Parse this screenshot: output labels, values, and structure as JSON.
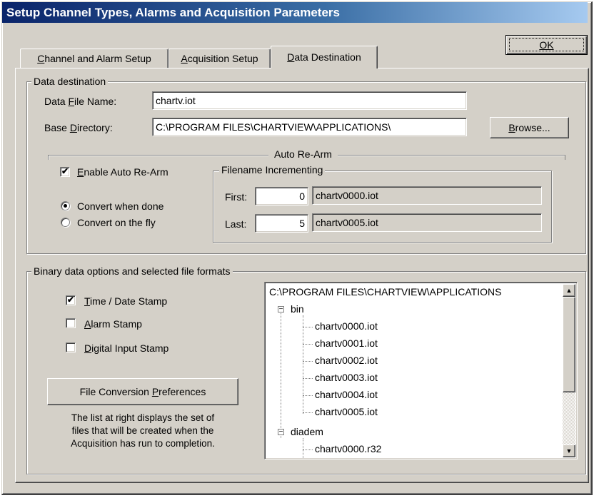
{
  "window": {
    "title": "Setup Channel Types, Alarms and Acquisition Parameters"
  },
  "ok_button": {
    "label": "OK"
  },
  "tabs": [
    {
      "pre": "",
      "key": "C",
      "post": "hannel and Alarm Setup"
    },
    {
      "pre": "",
      "key": "A",
      "post": "cquisition Setup"
    },
    {
      "pre": "",
      "key": "D",
      "post": "ata Destination"
    }
  ],
  "data_destination": {
    "group_label": "Data destination",
    "file_name_label": {
      "pre": "Data ",
      "key": "F",
      "post": "ile Name:"
    },
    "file_name_value": "chartv.iot",
    "base_dir_label": {
      "pre": "Base ",
      "key": "D",
      "post": "irectory:"
    },
    "base_dir_value": "C:\\PROGRAM FILES\\CHARTVIEW\\APPLICATIONS\\",
    "browse_button": {
      "key": "B",
      "post": "rowse..."
    },
    "auto_rearm": {
      "label": "Auto Re-Arm",
      "enable_checkbox": {
        "key": "E",
        "post": "nable Auto Re-Arm",
        "checked": true
      },
      "convert_when_done": {
        "label": "Convert when done",
        "selected": true
      },
      "convert_on_fly": {
        "label": "Convert on the fly",
        "selected": false
      },
      "filename_incrementing": {
        "group_label": "Filename Incrementing",
        "first_label": "First:",
        "first_value": "0",
        "first_filename": "chartv0000.iot",
        "last_label": "Last:",
        "last_value": "5",
        "last_filename": "chartv0005.iot"
      }
    }
  },
  "binary_options": {
    "group_label": "Binary data options and selected file formats",
    "time_date_stamp": {
      "key": "T",
      "post": "ime / Date Stamp",
      "checked": true
    },
    "alarm_stamp": {
      "key": "A",
      "post": "larm Stamp",
      "checked": false
    },
    "digital_input_stamp": {
      "key": "D",
      "post": "igital Input Stamp",
      "checked": false
    },
    "file_conversion_button": {
      "pre": "File Conversion ",
      "key": "P",
      "post": "references"
    },
    "help_text": [
      "The list at right displays the set of",
      "files that will be created when the",
      "Acquisition has run to completion."
    ],
    "tree": {
      "root": "C:\\PROGRAM FILES\\CHARTVIEW\\APPLICATIONS",
      "folder1": "bin",
      "folder1_files": [
        "chartv0000.iot",
        "chartv0001.iot",
        "chartv0002.iot",
        "chartv0003.iot",
        "chartv0004.iot",
        "chartv0005.iot"
      ],
      "folder2": "diadem",
      "folder2_files": [
        "chartv0000.r32"
      ]
    }
  },
  "colors": {
    "face": "#d4d0c8",
    "title_start": "#0a246a",
    "title_end": "#a6caf0"
  }
}
